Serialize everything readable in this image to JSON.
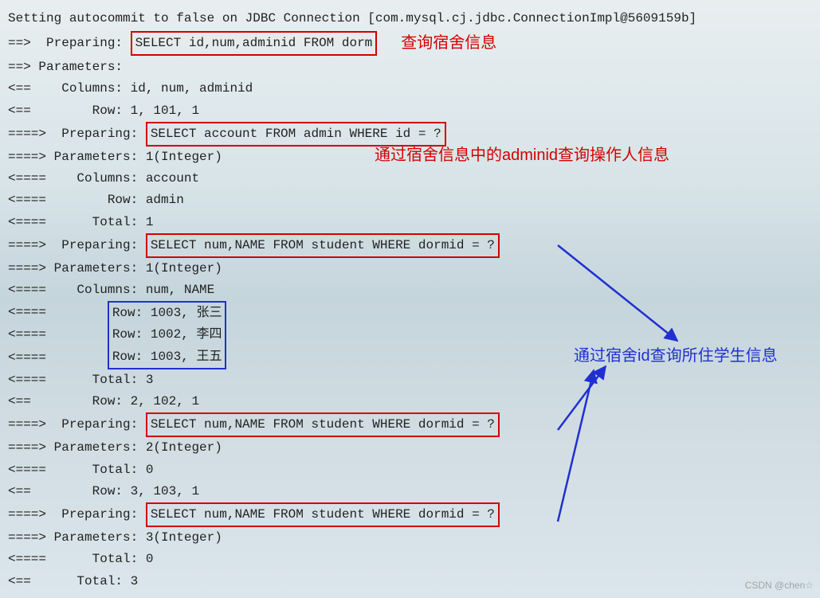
{
  "lines": {
    "l0": "Setting autocommit to false on JDBC Connection [com.mysql.cj.jdbc.ConnectionImpl@5609159b]",
    "l1_prefix": "==>  Preparing: ",
    "l1_sql": "SELECT id,num,adminid FROM dorm",
    "l1_note": "查询宿舍信息",
    "l2": "==> Parameters: ",
    "l3": "<==    Columns: id, num, adminid",
    "l4": "<==        Row: 1, 101, 1",
    "l5_prefix": "====>  Preparing: ",
    "l5_sql": "SELECT account FROM admin WHERE id = ?",
    "l6": "====> Parameters: 1(Integer)",
    "l6_note": "通过宿舍信息中的adminid查询操作人信息",
    "l7": "<====    Columns: account",
    "l8": "<====        Row: admin",
    "l9": "<====      Total: 1",
    "l10_prefix": "====>  Preparing: ",
    "l10_sql": "SELECT num,NAME FROM student WHERE dormid = ?",
    "l11": "====> Parameters: 1(Integer)",
    "l12": "<====    Columns: num, NAME",
    "l13a": "<====        ",
    "l13b": "Row: 1003, 张三",
    "l14a": "<====        ",
    "l14b": "Row: 1002, 李四",
    "l15a": "<====        ",
    "l15b": "Row: 1003, 王五",
    "rows_note": "通过宿舍id查询所住学生信息",
    "l16": "<====      Total: 3",
    "l17": "<==        Row: 2, 102, 1",
    "l18_prefix": "====>  Preparing: ",
    "l18_sql": "SELECT num,NAME FROM student WHERE dormid = ?",
    "l19": "====> Parameters: 2(Integer)",
    "l20": "<====      Total: 0",
    "l21": "<==        Row: 3, 103, 1",
    "l22_prefix": "====>  Preparing: ",
    "l22_sql": "SELECT num,NAME FROM student WHERE dormid = ?",
    "l23": "====> Parameters: 3(Integer)",
    "l24": "<====      Total: 0",
    "l25": "<==      Total: 3"
  },
  "watermark": "CSDN @chen☆"
}
